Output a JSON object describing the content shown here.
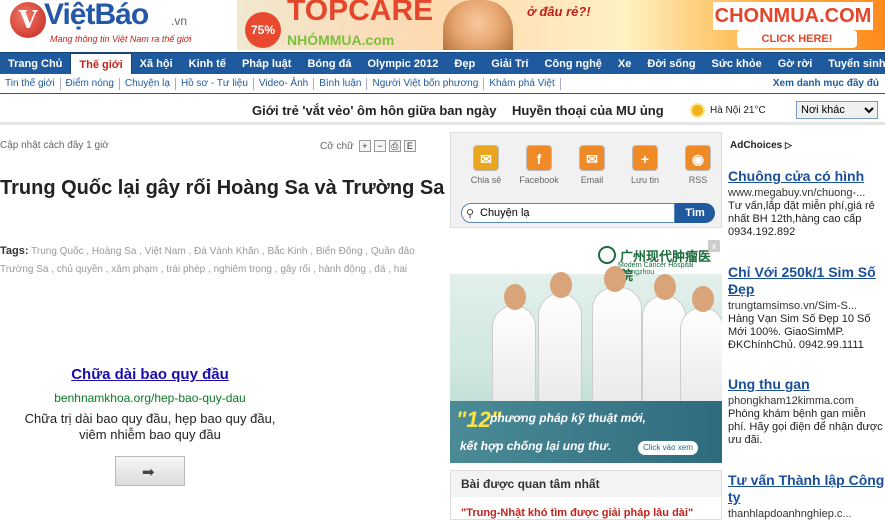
{
  "header": {
    "logo_letter": "V",
    "logo_name": "ViệtBáo",
    "logo_tld": ".vn",
    "logo_tagline": "Mang thông tin Việt Nam ra thế giới",
    "banner": {
      "badge": "75%",
      "brand": "TOPCARE",
      "brand_sub": "NHÓMMUA.com",
      "question": "ở đâu rẻ?!",
      "right_brand": "CHONMUA.COM",
      "cta": "CLICK HERE!"
    }
  },
  "nav": {
    "items": [
      "Trang Chủ",
      "Thế giới",
      "Xã hội",
      "Kinh tế",
      "Pháp luật",
      "Bóng đá",
      "Olympic 2012",
      "Đẹp",
      "Giải Trí",
      "Công nghệ",
      "Xe",
      "Đời sống",
      "Sức khỏe",
      "Gờ rời",
      "Tuyển sinh"
    ],
    "active": "Thế giới"
  },
  "subnav": {
    "items": [
      "Tin thế giới",
      "Điểm nóng",
      "Chuyện lạ",
      "Hồ sơ - Tư liệu",
      "Video- Ảnh",
      "Bình luận",
      "Người Việt bốn phương",
      "Khám phá Việt"
    ],
    "more": "Xem danh mục đầy đủ"
  },
  "ticker": {
    "headline_1": "Giới trẻ 'vắt vẻo' ôm hôn giữa ban ngày",
    "headline_2": "Huyền thoại của MU ủng",
    "weather": "Hà Nội 21°C",
    "city_select": "Nơi khác"
  },
  "article": {
    "updated": "Cập nhật cách đây 1 giờ",
    "font_label": "Cỡ chữ",
    "tool_plus": "+",
    "tool_minus": "−",
    "tool_print": "⎙",
    "tool_email": "E",
    "title": "Trung Quốc lại gây rối Hoàng Sa và Trường Sa",
    "tags_label": "Tags:",
    "tags": [
      "Trung Quốc",
      "Hoàng Sa",
      "Việt Nam",
      "Đá Vành Khăn",
      "Bắc Kinh",
      "Biển Đông",
      "Quần đảo Trường Sa",
      "chủ quyền",
      "xâm phạm",
      "trái phép",
      "nghiêm trọng",
      "gây rối",
      "hành động",
      "đá",
      "hai"
    ]
  },
  "text_ad": {
    "title": "Chữa dài bao quy đầu",
    "url": "benhnamkhoa.org/hep-bao-quy-dau",
    "desc": "Chữa trị dài bao quy đầu, hẹp bao quy đầu, viêm nhiễm bao quy đầu",
    "arrow": "➡"
  },
  "share": {
    "items": [
      {
        "label": "Chia sẻ",
        "glyph": "✉",
        "color": "#e9a51e"
      },
      {
        "label": "Facebook",
        "glyph": "f",
        "color": "#ef8a27"
      },
      {
        "label": "Email",
        "glyph": "✉",
        "color": "#ef8a27"
      },
      {
        "label": "Lưu tin",
        "glyph": "+",
        "color": "#ef8a27"
      },
      {
        "label": "RSS",
        "glyph": "◉",
        "color": "#ef8a27"
      }
    ],
    "search_value": "Chuyện lạ",
    "search_button": "Tìm"
  },
  "photo_ad": {
    "hospital_name": "广州现代肿瘤医院",
    "hospital_sub": "Modern Cancer Hospital Guangzhou",
    "number": "\"12\"",
    "line1": "phương pháp kỹ thuật mới,",
    "line2": "kết hợp chống lại ung thư.",
    "cta": "Click vào xem",
    "close": "x"
  },
  "related": {
    "heading": "Bài được quan tâm nhất",
    "first_item": "\"Trung-Nhật khó tìm được giải pháp lâu dài\""
  },
  "side_ads": {
    "adchoices": "AdChoices",
    "items": [
      {
        "title": "Chuông cửa có hình",
        "url": "www.megabuy.vn/chuong-...",
        "desc": "Tư vấn,lắp đặt miễn phí,giá rẻ nhất BH 12th,hàng cao cấp 0934.192.892"
      },
      {
        "title": "Chỉ Với 250k/1 Sim Số Đẹp",
        "url": "trungtamsimso.vn/Sim-S...",
        "desc": "Hàng Vạn Sim Số Đẹp 10 Số Mới 100%. GiaoSimMP. ĐKChínhChủ. 0942.99.1111"
      },
      {
        "title": "Ung thu gan",
        "url": "phongkham12kimma.com",
        "desc": "Phòng khám bệnh gan miễn phí. Hãy gọi điện để nhận được ưu đãi."
      },
      {
        "title": "Tư vấn Thành lập Công ty",
        "url": "thanhlapdoanhnghiep.c...",
        "desc": ""
      }
    ]
  }
}
